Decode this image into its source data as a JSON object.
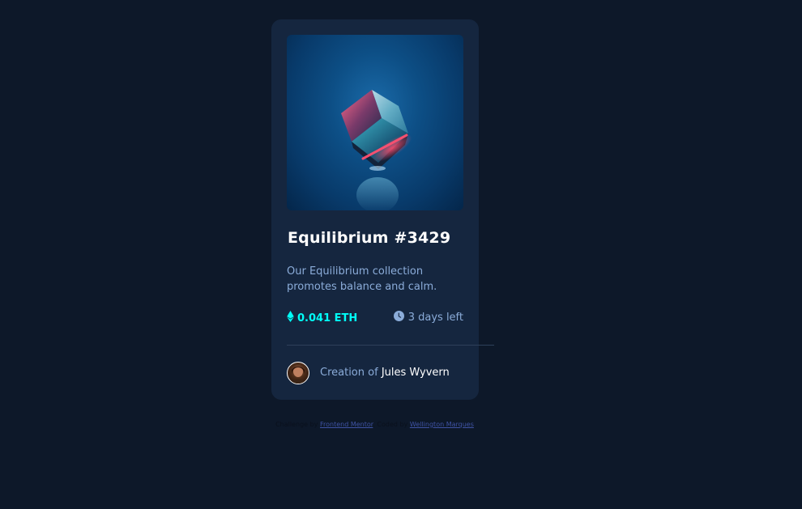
{
  "card": {
    "title": "Equilibrium #3429",
    "description": "Our Equilibrium collection promotes balance and calm.",
    "price": "0.041 ETH",
    "price_icon": "ethereum-icon",
    "time_left": "3 days left",
    "time_icon": "clock-icon",
    "creator_prefix": "Creation of",
    "creator_name": "Jules Wyvern"
  },
  "attribution": {
    "challenge_prefix": "Challenge by",
    "challenge_link": "Frontend Mentor",
    "coded_prefix": ". Coded by",
    "coded_link": "Wellington Marques"
  },
  "colors": {
    "background": "#0d1829",
    "card": "#15263f",
    "accent": "#00fff8",
    "soft_blue": "#8bacd9",
    "white": "#ffffff"
  }
}
